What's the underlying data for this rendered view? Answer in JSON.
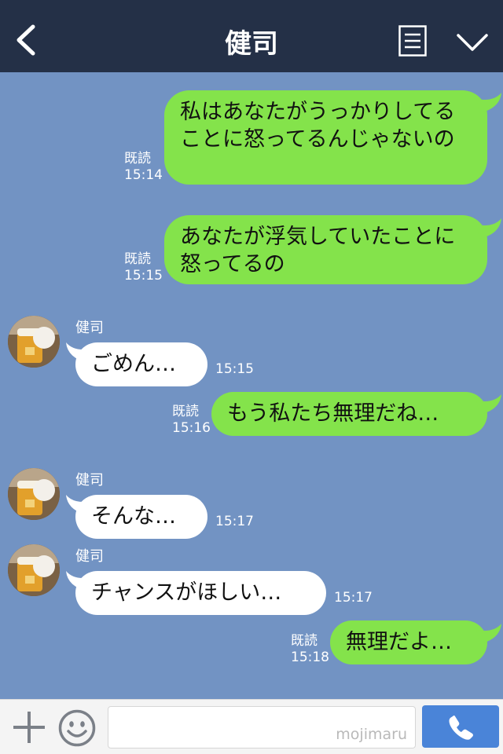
{
  "header": {
    "title": "健司"
  },
  "messages": [
    {
      "text": "私はあなたがうっかりしてることに怒ってるんじゃないの",
      "read": "既読",
      "time": "15:14"
    },
    {
      "text": "あなたが浮気していたことに怒ってるの",
      "read": "既読",
      "time": "15:15"
    },
    {
      "sender": "健司",
      "text": "ごめん…",
      "time": "15:15"
    },
    {
      "text": "もう私たち無理だね…",
      "read": "既読",
      "time": "15:16"
    },
    {
      "sender": "健司",
      "text": "そんな…",
      "time": "15:17"
    },
    {
      "sender": "健司",
      "text": "チャンスがほしい…",
      "time": "15:17"
    },
    {
      "text": "無理だよ…",
      "read": "既読",
      "time": "15:18"
    }
  ],
  "footer": {
    "watermark": "mojimaru"
  },
  "colors": {
    "header": "#243047",
    "background": "#7293c3",
    "outgoing_bubble": "#84e34b",
    "incoming_bubble": "#ffffff",
    "send_button": "#4a84d8"
  },
  "icons": [
    "back-arrow-icon",
    "menu-list-icon",
    "chevron-down-icon",
    "plus-icon",
    "smile-icon",
    "phone-icon"
  ]
}
